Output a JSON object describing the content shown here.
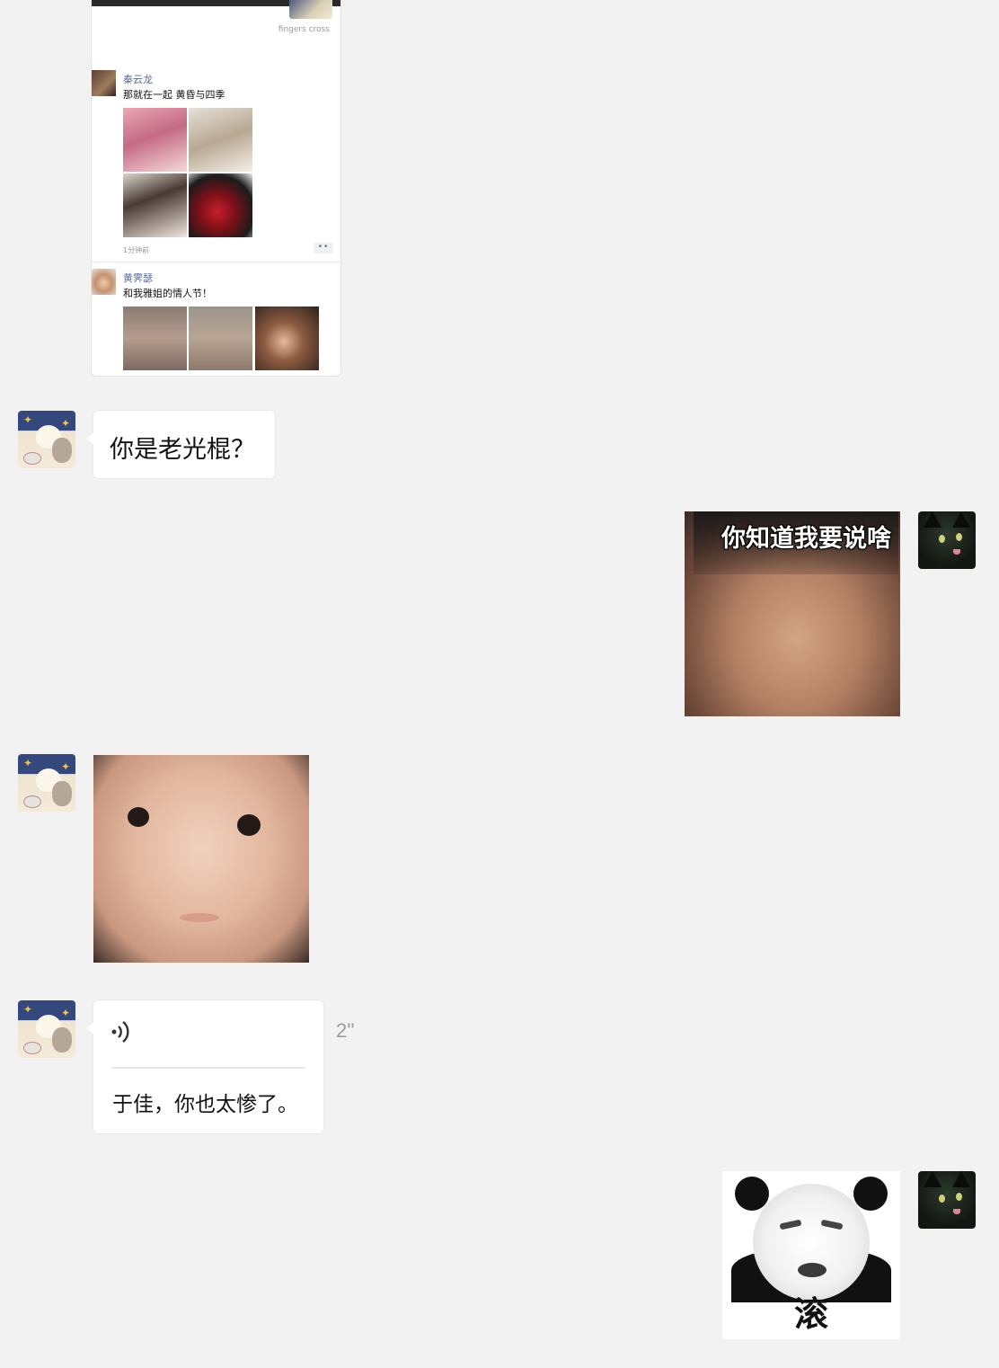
{
  "moments_screenshot": {
    "sticker_caption": "fingers cross",
    "posts": [
      {
        "name": "秦云龙",
        "text": "那就在一起 黄昏与四季",
        "time": "1分钟前",
        "more": "••"
      },
      {
        "name": "黄霁瑟",
        "text": "和我雅姐的情人节！"
      }
    ]
  },
  "messages": [
    {
      "id": "m1",
      "side": "left",
      "type": "text",
      "text": "你是老光棍？"
    },
    {
      "id": "m2",
      "side": "right",
      "type": "sticker",
      "caption": "你知道我要说啥"
    },
    {
      "id": "m3",
      "side": "left",
      "type": "sticker",
      "caption": ""
    },
    {
      "id": "m4",
      "side": "left",
      "type": "voice",
      "duration": "2''",
      "transcript": "于佳，你也太惨了。"
    },
    {
      "id": "m5",
      "side": "right",
      "type": "sticker",
      "caption": "滚"
    }
  ],
  "avatars": {
    "left_user": "bear-sticker-avatar",
    "right_user": "black-cat-avatar"
  },
  "colors": {
    "background": "#f2f2f2",
    "bubble": "#ffffff",
    "name_link": "#576b95",
    "duration": "#9b9b9b"
  }
}
